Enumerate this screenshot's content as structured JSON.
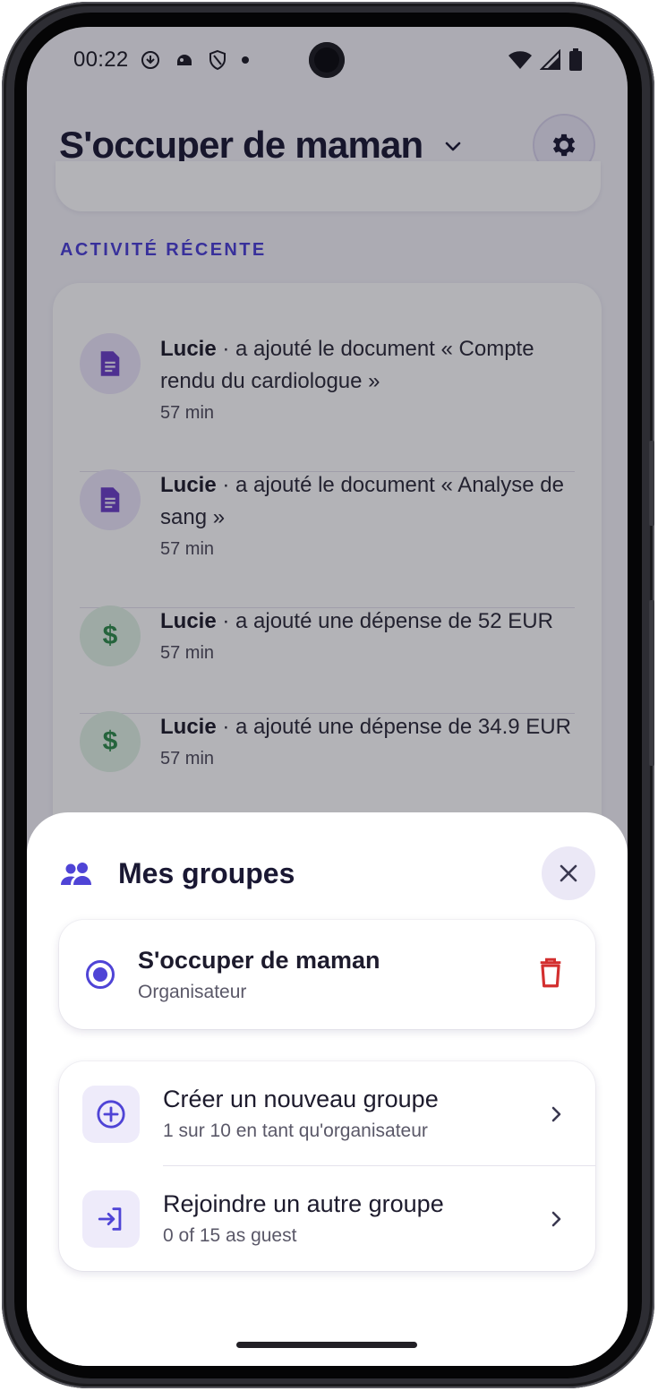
{
  "status_bar": {
    "time": "00:22"
  },
  "header": {
    "title": "S'occuper de maman"
  },
  "recent": {
    "section_label": "ACTIVITÉ RÉCENTE",
    "items": [
      {
        "user": "Lucie",
        "text": " · a ajouté le document « Compte rendu du cardiologue »",
        "time": "57 min",
        "icon": "document-icon"
      },
      {
        "user": "Lucie",
        "text": " · a ajouté le document « Analyse de sang »",
        "time": "57 min",
        "icon": "document-icon"
      },
      {
        "user": "Lucie",
        "text": " · a ajouté une dépense de 52 EUR",
        "time": "57 min",
        "icon": "dollar-icon"
      },
      {
        "user": "Lucie",
        "text": " · a ajouté une dépense de 34.9 EUR",
        "time": "57 min",
        "icon": "dollar-icon"
      }
    ]
  },
  "sheet": {
    "title": "Mes groupes",
    "group": {
      "name": "S'occuper de maman",
      "role": "Organisateur"
    },
    "actions": [
      {
        "title": "Créer un nouveau groupe",
        "subtitle": "1 sur 10 en tant qu'organisateur",
        "icon": "add-circle-icon"
      },
      {
        "title": "Rejoindre un autre groupe",
        "subtitle": "0 of 15 as guest",
        "icon": "login-arrow-icon"
      }
    ]
  },
  "colors": {
    "accent": "#4f44d6",
    "danger": "#d32f2f",
    "document_icon": "#6b3fc8",
    "money_icon": "#2e8b4a"
  }
}
